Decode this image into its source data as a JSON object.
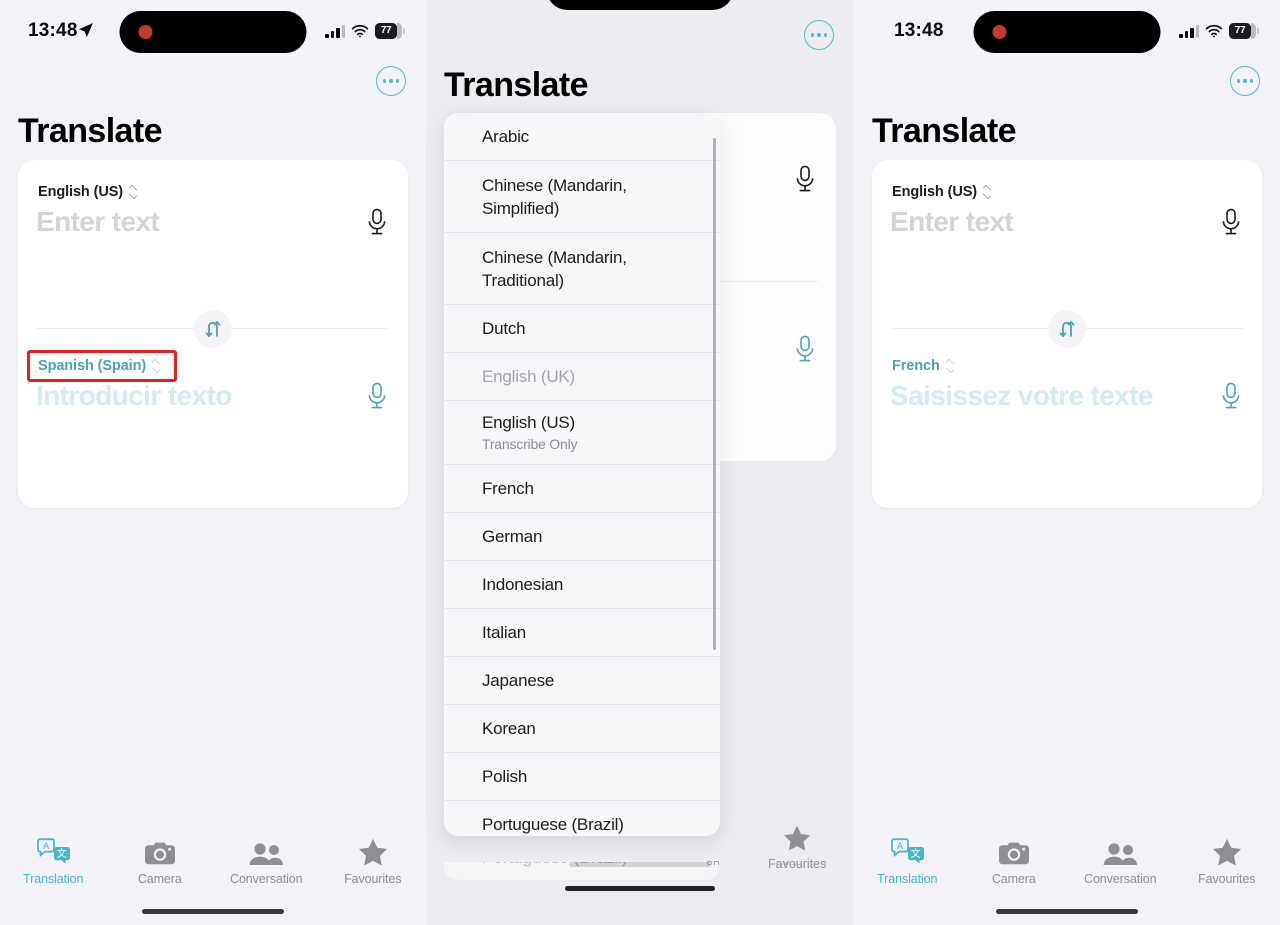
{
  "theme": {
    "accent": "#4ab5c4",
    "accent_dim": "#5ab8c4",
    "annotation": "#e8201a",
    "background": "#f2f2f7",
    "card": "#ffffff",
    "text": "#1c1c1e",
    "muted": "#8e8e93",
    "placeholder_src": "#d4d4d8",
    "placeholder_dst": "#d6eaef"
  },
  "status_bar": {
    "time": "13:48",
    "battery_percent": "77",
    "location_icon": "location-arrow-icon",
    "cellular_icon": "cellular-bars-icon",
    "wifi_icon": "wifi-icon",
    "battery_icon": "battery-icon"
  },
  "header": {
    "title": "Translate",
    "more_button": "more-ellipsis-icon"
  },
  "tabbar": {
    "items": [
      {
        "label": "Translation",
        "icon": "translation-bubbles-icon",
        "active": true
      },
      {
        "label": "Camera",
        "icon": "camera-icon",
        "active": false
      },
      {
        "label": "Conversation",
        "icon": "conversation-people-icon",
        "active": false
      },
      {
        "label": "Favourites",
        "icon": "star-icon",
        "active": false
      }
    ]
  },
  "panels": {
    "left": {
      "source": {
        "language": "English (US)",
        "placeholder": "Enter text",
        "mic_icon": "microphone-icon"
      },
      "target": {
        "language": "Spanish (Spain)",
        "placeholder": "Introducir texto",
        "mic_icon": "microphone-icon",
        "highlighted": true
      },
      "swap_icon": "swap-languages-icon"
    },
    "middle": {
      "title": "Translate",
      "picker_items": [
        {
          "name": "Arabic",
          "sub": "",
          "disabled": false
        },
        {
          "name": "Chinese (Mandarin, Simplified)",
          "sub": "",
          "disabled": false
        },
        {
          "name": "Chinese (Mandarin, Traditional)",
          "sub": "",
          "disabled": false
        },
        {
          "name": "Dutch",
          "sub": "",
          "disabled": false
        },
        {
          "name": "English (UK)",
          "sub": "",
          "disabled": true
        },
        {
          "name": "English (US)",
          "sub": "Transcribe Only",
          "disabled": false
        },
        {
          "name": "French",
          "sub": "",
          "disabled": false
        },
        {
          "name": "German",
          "sub": "",
          "disabled": false
        },
        {
          "name": "Indonesian",
          "sub": "",
          "disabled": false
        },
        {
          "name": "Italian",
          "sub": "",
          "disabled": false
        },
        {
          "name": "Japanese",
          "sub": "",
          "disabled": false
        },
        {
          "name": "Korean",
          "sub": "",
          "disabled": false
        },
        {
          "name": "Polish",
          "sub": "",
          "disabled": false
        },
        {
          "name": "Portuguese (Brazil)",
          "sub": "",
          "disabled": false
        }
      ],
      "behind_mic_top": "microphone-icon",
      "behind_mic_bottom": "microphone-icon",
      "partial_tab_label": "Favourites",
      "partial_tab_clipped": "on"
    },
    "right": {
      "source": {
        "language": "English (US)",
        "placeholder": "Enter text",
        "mic_icon": "microphone-icon"
      },
      "target": {
        "language": "French",
        "placeholder": "Saisissez votre texte",
        "mic_icon": "microphone-icon",
        "highlighted": false
      },
      "swap_icon": "swap-languages-icon"
    }
  }
}
